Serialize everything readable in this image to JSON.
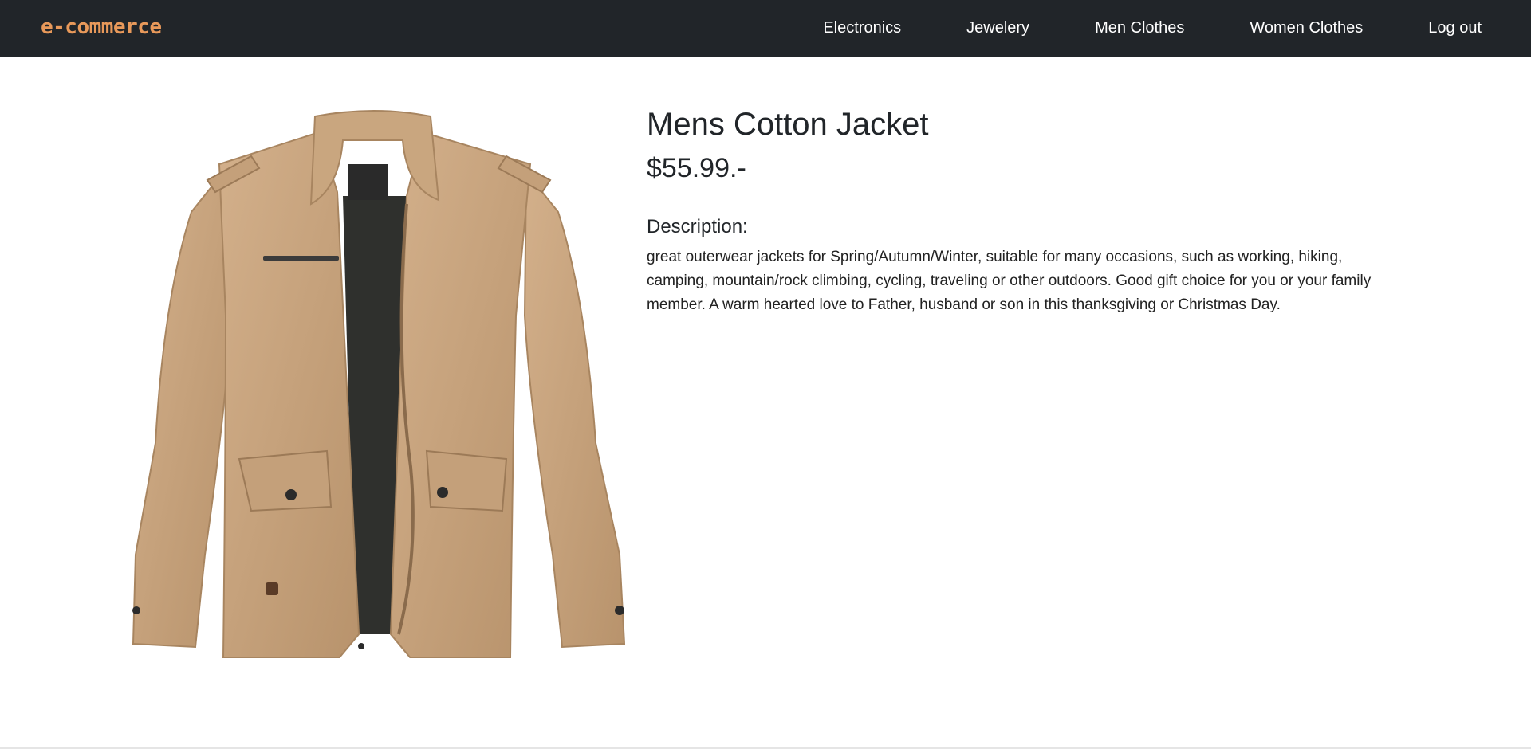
{
  "navbar": {
    "brand": "e-commerce",
    "links": [
      "Electronics",
      "Jewelery",
      "Men Clothes",
      "Women Clothes",
      "Log out"
    ],
    "background": "#212529",
    "brand_color": "#e8995a"
  },
  "product": {
    "title": "Mens Cotton Jacket",
    "price": "$55.99.-",
    "description_heading": "Description:",
    "description": "great outerwear jackets for Spring/Autumn/Winter, suitable for many occasions, such as working, hiking, camping, mountain/rock climbing, cycling, traveling or other outdoors. Good gift choice for you or your family member. A warm hearted love to Father, husband or son in this thanksgiving or Christmas Day.",
    "image": "khaki-jacket-image"
  }
}
